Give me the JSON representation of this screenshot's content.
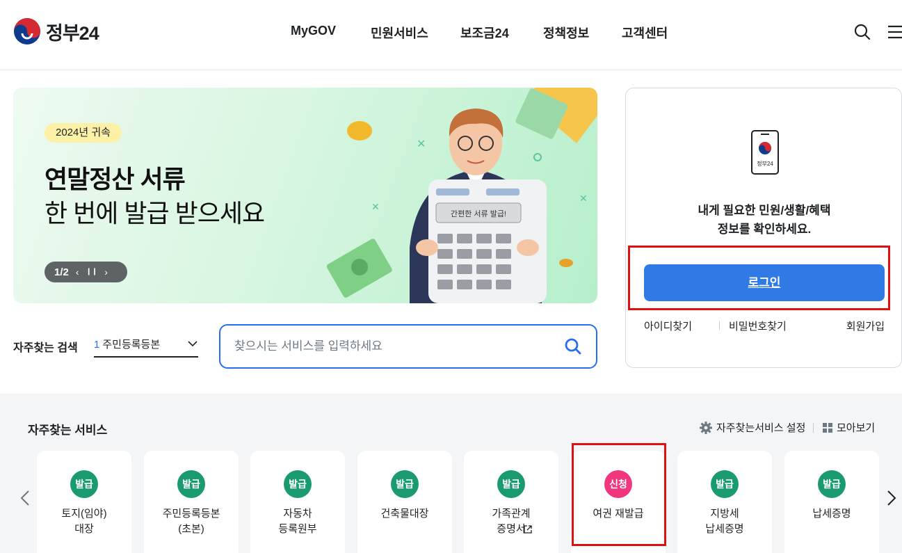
{
  "header": {
    "logo_text": "정부24",
    "nav": [
      "MyGOV",
      "민원서비스",
      "보조금24",
      "정책정보",
      "고객센터"
    ],
    "icons": [
      "search-icon",
      "menu-icon"
    ]
  },
  "banner": {
    "tag": "2024년 귀속",
    "title_line1": "연말정산 서류",
    "title_line2": "한 번에 발급 받으세요",
    "calculator_label": "간편한 서류 발급!",
    "page_indicator": "1/2",
    "controls": [
      "prev-icon",
      "pause-icon",
      "next-icon"
    ]
  },
  "search": {
    "favorite_label": "자주찾는 검색",
    "favorite_rank": "1",
    "favorite_value": "주민등록등본",
    "placeholder": "찾으시는 서비스를 입력하세요"
  },
  "login": {
    "device_label": "정부24",
    "message_line1": "내게 필요한 민원/생활/혜택",
    "message_line2": "정보를 확인하세요.",
    "button": "로그인",
    "find_id": "아이디찾기",
    "find_password": "비밀번호찾기",
    "signup": "회원가입"
  },
  "services": {
    "title": "자주찾는 서비스",
    "setting_label": "자주찾는서비스 설정",
    "view_all_label": "모아보기",
    "colors": {
      "issue": "#1a9a70",
      "apply": "#f0367c"
    },
    "items": [
      {
        "badge": "발급",
        "name": "토지(임야)\n대장"
      },
      {
        "badge": "발급",
        "name": "주민등록등본\n(초본)"
      },
      {
        "badge": "발급",
        "name": "자동차\n등록원부"
      },
      {
        "badge": "발급",
        "name": "건축물대장"
      },
      {
        "badge": "발급",
        "name": "가족관계\n증명서"
      },
      {
        "badge": "신청",
        "name": "여권 재발급"
      },
      {
        "badge": "발급",
        "name": "지방세\n납세증명"
      },
      {
        "badge": "발급",
        "name": "납세증명"
      }
    ]
  }
}
